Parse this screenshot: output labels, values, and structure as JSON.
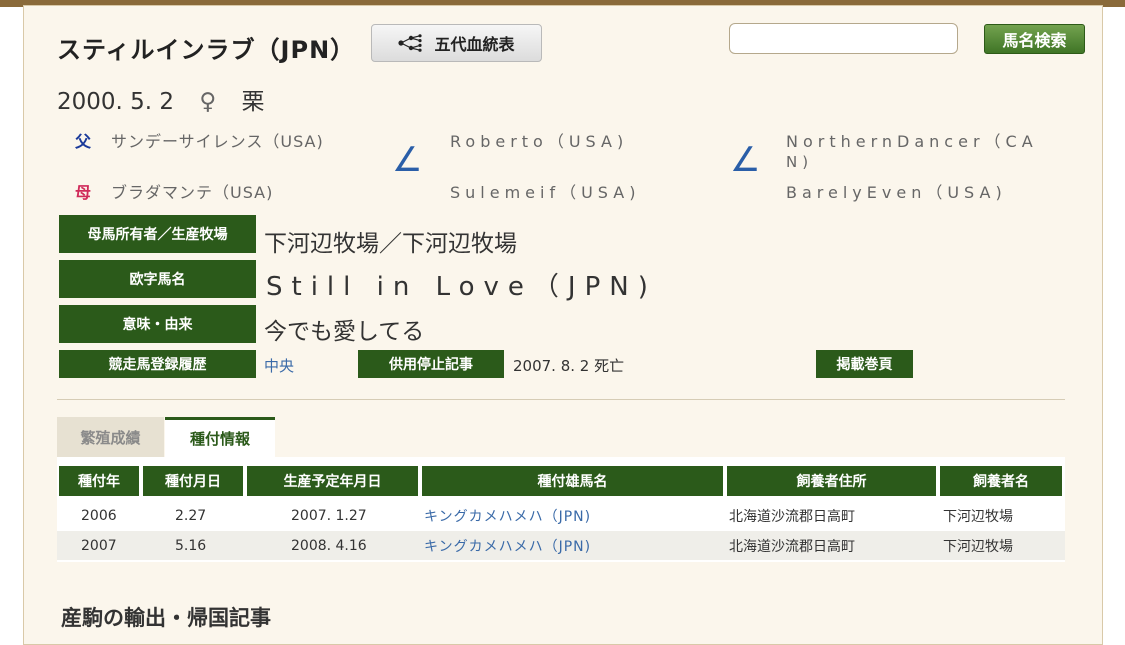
{
  "horse": {
    "name": "スティルインラブ（JPN）",
    "pedigree_button": "五代血統表",
    "birth_date": "2000. 5. 2",
    "sex_symbol": "♀",
    "color": "栗"
  },
  "search": {
    "placeholder": "",
    "button_label": "馬名検索"
  },
  "pedigree": {
    "sire_label": "父",
    "sire": "サンデーサイレンス（USA)",
    "dam_label": "母",
    "dam": "ブラダマンテ（USA)",
    "sire_sire": "Roberto（USA)",
    "dam_sire": "Sulemeif（USA)",
    "grand1": "NorthernDancer（CA",
    "grand1b": "N)",
    "grand2": "BarelyEven（USA)"
  },
  "info": {
    "owner_label": "母馬所有者／生産牧場",
    "owner_value": "下河辺牧場／下河辺牧場",
    "roman_label": "欧字馬名",
    "roman_value": "Still in Love（JPN)",
    "meaning_label": "意味・由来",
    "meaning_value": "今でも愛してる",
    "registry_label": "競走馬登録履歴",
    "registry_value": "中央",
    "retire_label": "供用停止記事",
    "retire_value": "2007. 8. 2 死亡",
    "page_label": "掲載巻頁"
  },
  "tabs": [
    {
      "label": "繁殖成績"
    },
    {
      "label": "種付情報"
    }
  ],
  "table": {
    "headers": [
      "種付年",
      "種付月日",
      "生産予定年月日",
      "種付雄馬名",
      "飼養者住所",
      "飼養者名"
    ],
    "rows": [
      [
        "2006",
        "2.27",
        "2007. 1.27",
        "キングカメハメハ（JPN)",
        "北海道沙流郡日高町",
        "下河辺牧場"
      ],
      [
        "2007",
        "5.16",
        "2008. 4.16",
        "キングカメハメハ（JPN)",
        "北海道沙流郡日高町",
        "下河辺牧場"
      ]
    ]
  },
  "section": {
    "title": "産駒の輸出・帰国記事"
  },
  "colors": {
    "header_green": "#2b5a1a",
    "panel_bg": "#fbf6ec",
    "link_blue": "#3a6aa8",
    "sire_blue": "#1a3a9a",
    "dam_red": "#d02a5a"
  }
}
